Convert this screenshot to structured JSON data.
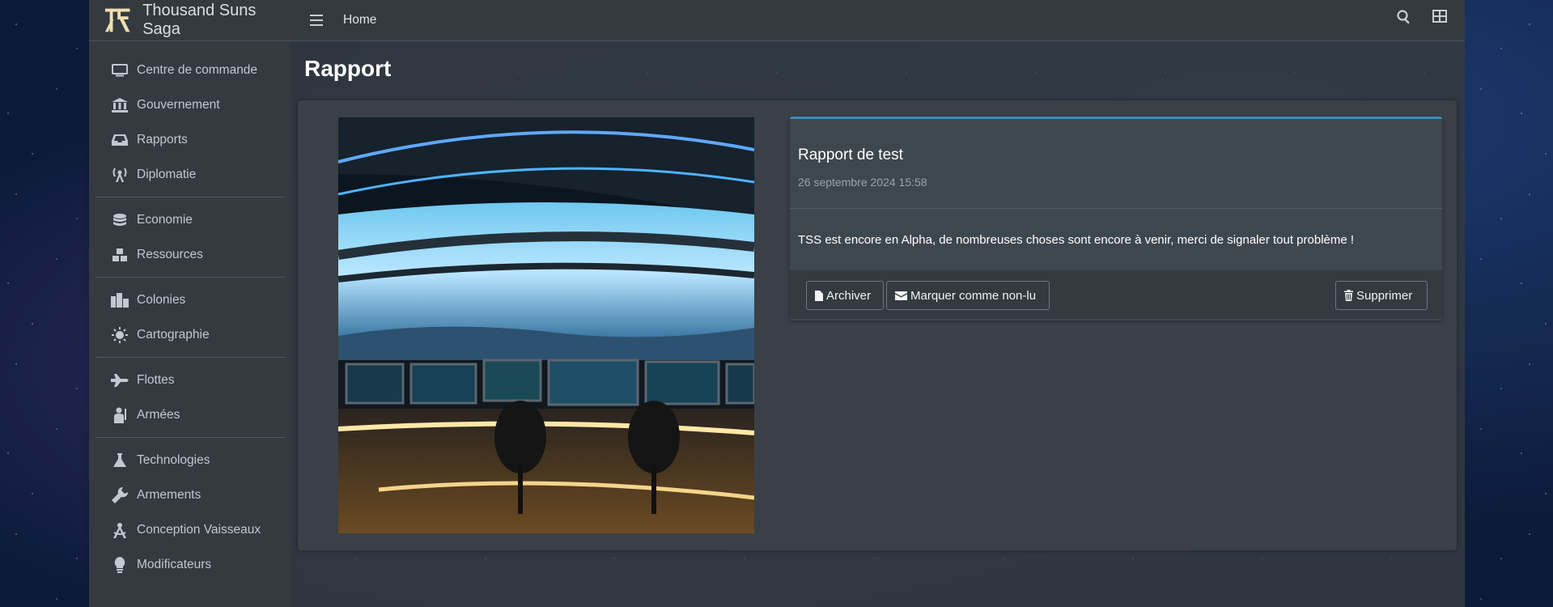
{
  "brand": {
    "title": "Thousand Suns Saga",
    "logo_icon": "tss-logo-icon"
  },
  "sidebar": {
    "groups": [
      {
        "items": [
          {
            "label": "Centre de commande",
            "icon": "monitor-icon"
          },
          {
            "label": "Gouvernement",
            "icon": "landmark-icon"
          },
          {
            "label": "Rapports",
            "icon": "inbox-icon"
          },
          {
            "label": "Diplomatie",
            "icon": "broadcast-tower-icon"
          }
        ]
      },
      {
        "items": [
          {
            "label": "Economie",
            "icon": "coins-icon"
          },
          {
            "label": "Ressources",
            "icon": "cubes-icon"
          }
        ]
      },
      {
        "items": [
          {
            "label": "Colonies",
            "icon": "city-icon"
          },
          {
            "label": "Cartographie",
            "icon": "sun-icon"
          }
        ]
      },
      {
        "items": [
          {
            "label": "Flottes",
            "icon": "fighter-jet-icon"
          },
          {
            "label": "Armées",
            "icon": "soldier-icon"
          }
        ]
      },
      {
        "items": [
          {
            "label": "Technologies",
            "icon": "flask-icon"
          },
          {
            "label": "Armements",
            "icon": "wrench-icon"
          },
          {
            "label": "Conception Vaisseaux",
            "icon": "drafting-compass-icon"
          },
          {
            "label": "Modificateurs",
            "icon": "lightbulb-icon"
          }
        ]
      }
    ]
  },
  "navbar": {
    "home": "Home",
    "menu_icon": "bars-icon",
    "search_icon": "search-icon",
    "apps_icon": "grid-icon"
  },
  "page": {
    "title": "Rapport"
  },
  "report": {
    "title": "Rapport de test",
    "date": "26 septembre 2024 15:58",
    "body": "TSS est encore en Alpha, de nombreuses choses sont encore à venir, merci de signaler tout problème !",
    "actions": {
      "archive": "Archiver",
      "mark_unread": "Marquer comme non-lu",
      "delete": "Supprimer"
    }
  },
  "colors": {
    "accent": "#3c8dbc",
    "sidebar_bg": "#343a40",
    "card_bg": "#3f474e"
  }
}
